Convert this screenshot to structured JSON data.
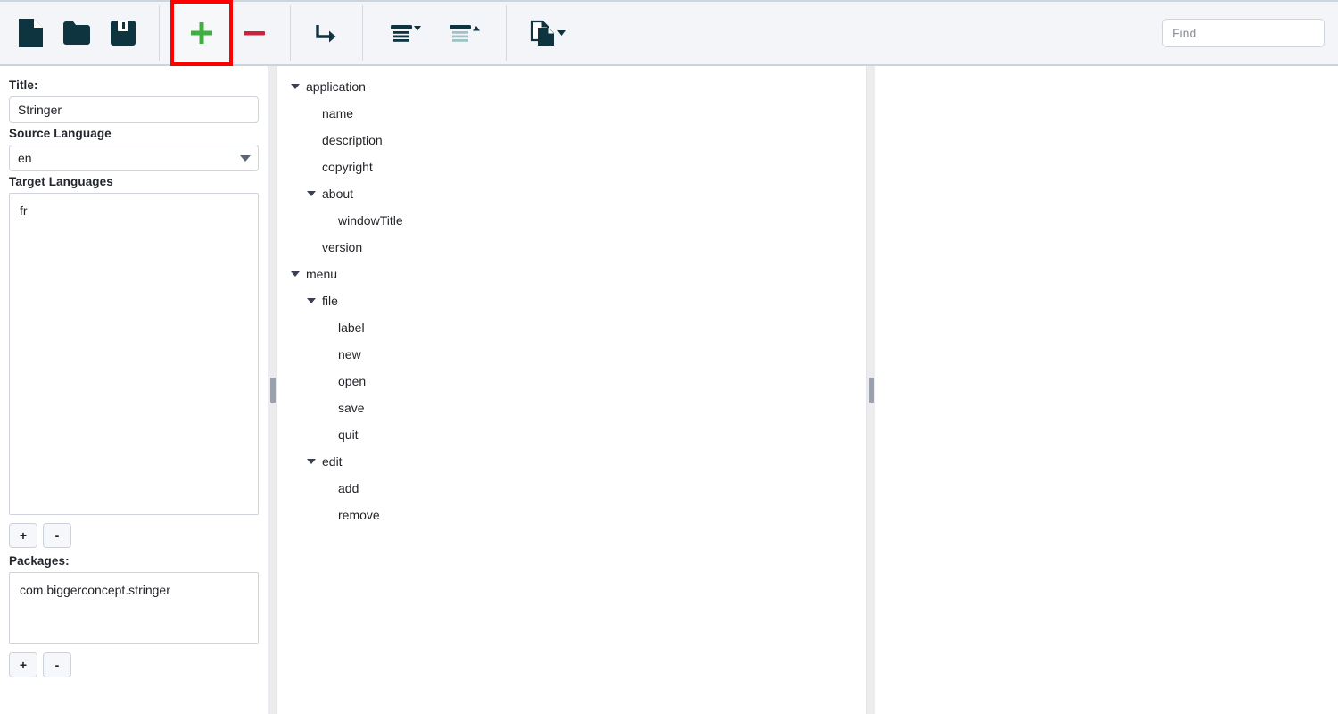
{
  "window": {
    "title": "Stringer"
  },
  "toolbar": {
    "buttons": [
      {
        "name": "new-file-button",
        "icon": "document-icon",
        "tooltip": "New"
      },
      {
        "name": "open-file-button",
        "icon": "folder-icon",
        "tooltip": "Open"
      },
      {
        "name": "save-file-button",
        "icon": "floppy-disk-icon",
        "tooltip": "Save"
      },
      {
        "name": "add-button",
        "icon": "plus-icon",
        "tooltip": "Add",
        "highlighted": true
      },
      {
        "name": "remove-button",
        "icon": "minus-icon",
        "tooltip": "Remove"
      },
      {
        "name": "move-button",
        "icon": "arrow-turn-right-icon",
        "tooltip": "Move"
      },
      {
        "name": "collapse-all-button",
        "icon": "collapse-icon",
        "tooltip": "Collapse"
      },
      {
        "name": "expand-all-button",
        "icon": "expand-icon",
        "tooltip": "Expand"
      },
      {
        "name": "duplicate-button",
        "icon": "copy-pages-icon",
        "tooltip": "Duplicate"
      }
    ],
    "find": {
      "placeholder": "Find",
      "value": ""
    },
    "highlight_color": "#ff0000",
    "add_icon_color": "#3faf3f",
    "remove_icon_color": "#c8243f",
    "icon_color": "#0e3440"
  },
  "left_panel": {
    "title": {
      "label": "Title:",
      "value": "Stringer"
    },
    "source_language": {
      "label": "Source Language",
      "value": "en",
      "options": [
        "en"
      ]
    },
    "target_languages": {
      "label": "Target Languages",
      "items": [
        "fr"
      ],
      "add_label": "+",
      "remove_label": "-"
    },
    "packages": {
      "label": "Packages:",
      "items": [
        "com.biggerconcept.stringer"
      ],
      "add_label": "+",
      "remove_label": "-"
    }
  },
  "tree": {
    "nodes": [
      {
        "label": "application",
        "depth": 0,
        "expandable": true,
        "expanded": true
      },
      {
        "label": "name",
        "depth": 1,
        "expandable": false,
        "expanded": false
      },
      {
        "label": "description",
        "depth": 1,
        "expandable": false,
        "expanded": false
      },
      {
        "label": "copyright",
        "depth": 1,
        "expandable": false,
        "expanded": false
      },
      {
        "label": "about",
        "depth": 1,
        "expandable": true,
        "expanded": true
      },
      {
        "label": "windowTitle",
        "depth": 2,
        "expandable": false,
        "expanded": false
      },
      {
        "label": "version",
        "depth": 1,
        "expandable": false,
        "expanded": false
      },
      {
        "label": "menu",
        "depth": 0,
        "expandable": true,
        "expanded": true
      },
      {
        "label": "file",
        "depth": 1,
        "expandable": true,
        "expanded": true
      },
      {
        "label": "label",
        "depth": 2,
        "expandable": false,
        "expanded": false
      },
      {
        "label": "new",
        "depth": 2,
        "expandable": false,
        "expanded": false
      },
      {
        "label": "open",
        "depth": 2,
        "expandable": false,
        "expanded": false
      },
      {
        "label": "save",
        "depth": 2,
        "expandable": false,
        "expanded": false
      },
      {
        "label": "quit",
        "depth": 2,
        "expandable": false,
        "expanded": false
      },
      {
        "label": "edit",
        "depth": 1,
        "expandable": true,
        "expanded": true
      },
      {
        "label": "add",
        "depth": 2,
        "expandable": false,
        "expanded": false
      },
      {
        "label": "remove",
        "depth": 2,
        "expandable": false,
        "expanded": false
      }
    ]
  },
  "detail_panel": {
    "content": ""
  }
}
